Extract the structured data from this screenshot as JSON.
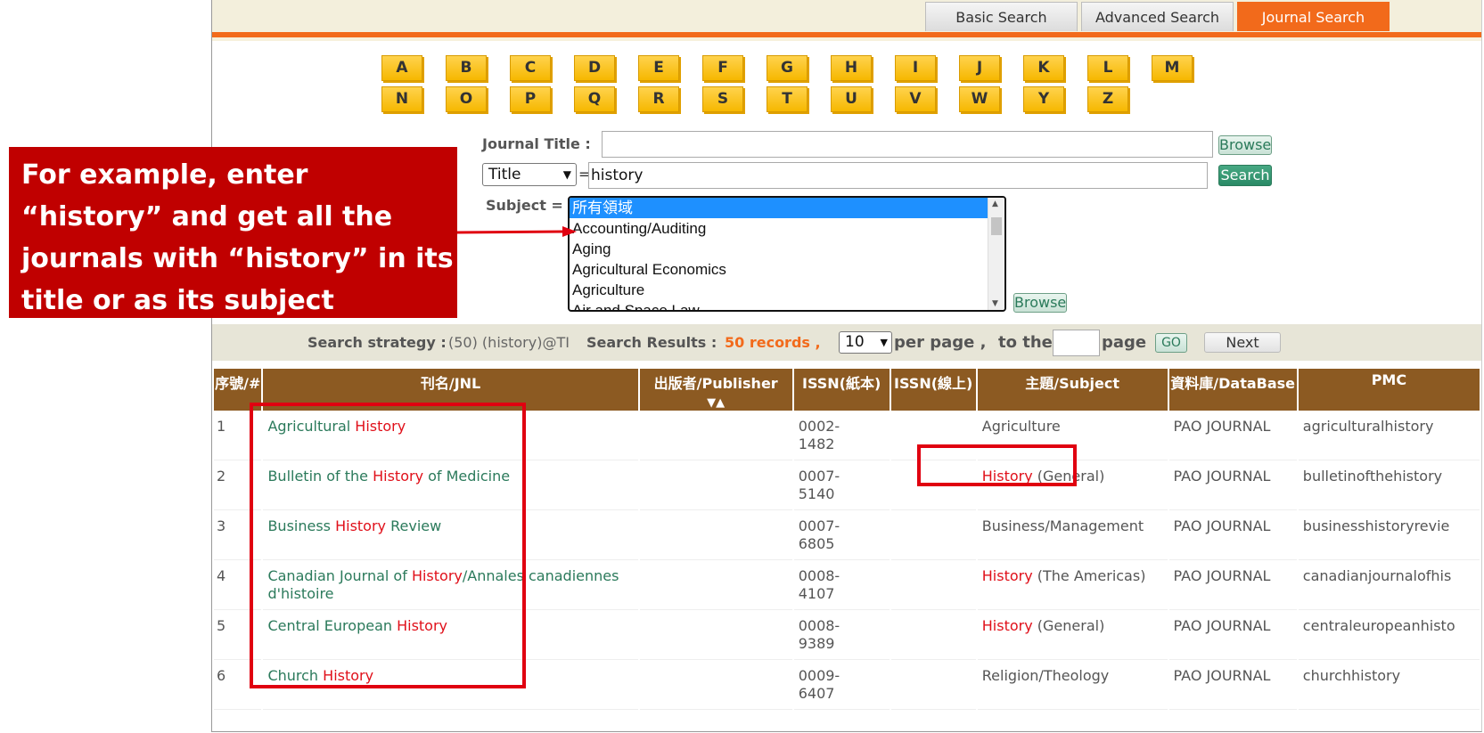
{
  "tabs": [
    "Basic Search",
    "Advanced Search",
    "Journal Search"
  ],
  "letters_row1": [
    "A",
    "B",
    "C",
    "D",
    "E",
    "F",
    "G",
    "H",
    "I",
    "J",
    "K",
    "L",
    "M"
  ],
  "letters_row2": [
    "N",
    "O",
    "P",
    "Q",
    "R",
    "S",
    "T",
    "U",
    "V",
    "W",
    "Y",
    "Z"
  ],
  "form": {
    "journal_title_label": "Journal Title :",
    "browse_label": "Browse",
    "field_select": "Title",
    "equals": "=",
    "query_value": "history",
    "search_label": "Search",
    "subject_label": "Subject =",
    "subject_options": [
      "所有領域",
      "Accounting/Auditing",
      "Aging",
      "Agricultural Economics",
      "Agriculture",
      "Air and Space Law"
    ],
    "browse2_label": "Browse"
  },
  "strategy": {
    "label": "Search strategy :",
    "value": "(50) (history)@TI",
    "results_label": "Search Results :",
    "results_value": "50 records ,",
    "per_page_value": "10",
    "per_page_label": "per page ,",
    "to_the": "to the",
    "page_label": "page",
    "go_label": "GO",
    "next_label": "Next"
  },
  "table": {
    "headers": [
      "序號/#",
      "刊名/JNL",
      "出版者/Publisher",
      "ISSN(紙本)",
      "ISSN(線上)",
      "主題/Subject",
      "資料庫/DataBase",
      "PMC"
    ],
    "sort_arrows": "▼▲",
    "rows": [
      {
        "num": "1",
        "t1": "Agricultural ",
        "t2": "History",
        "t3": "",
        "t4": "",
        "t5": "",
        "issn": "0002-1482",
        "s1": "",
        "s2": "Agriculture",
        "db": "PAO JOURNAL",
        "pmc": "agriculturalhistory"
      },
      {
        "num": "2",
        "t1": "Bulletin of the ",
        "t2": "History",
        "t3": " of Medicine",
        "t4": "",
        "t5": "",
        "issn": "0007-5140",
        "s1": "History",
        "s2": " (General)",
        "db": "PAO JOURNAL",
        "pmc": "bulletinofthehistory"
      },
      {
        "num": "3",
        "t1": "Business ",
        "t2": "History",
        "t3": " Review",
        "t4": "",
        "t5": "",
        "issn": "0007-6805",
        "s1": "",
        "s2": "Business/Management",
        "db": "PAO JOURNAL",
        "pmc": "businesshistoryrevie"
      },
      {
        "num": "4",
        "t1": "Canadian Journal of ",
        "t2": "History",
        "t3": "/Annales canadiennes d'histoire",
        "t4": "",
        "t5": "",
        "issn": "0008-4107",
        "s1": "History",
        "s2": " (The Americas)",
        "db": "PAO JOURNAL",
        "pmc": "canadianjournalofhis"
      },
      {
        "num": "5",
        "t1": "Central European ",
        "t2": "History",
        "t3": "",
        "t4": "",
        "t5": "",
        "issn": "0008-9389",
        "s1": "History",
        "s2": " (General)",
        "db": "PAO JOURNAL",
        "pmc": "centraleuropeanhisto"
      },
      {
        "num": "6",
        "t1": "Church ",
        "t2": "History",
        "t3": "",
        "t4": "",
        "t5": "",
        "issn": "0009-6407",
        "s1": "",
        "s2": "Religion/Theology",
        "db": "PAO JOURNAL",
        "pmc": "churchhistory"
      }
    ]
  },
  "callout": "For example, enter “history” and get all the journals with “history” in its title or as its subject"
}
